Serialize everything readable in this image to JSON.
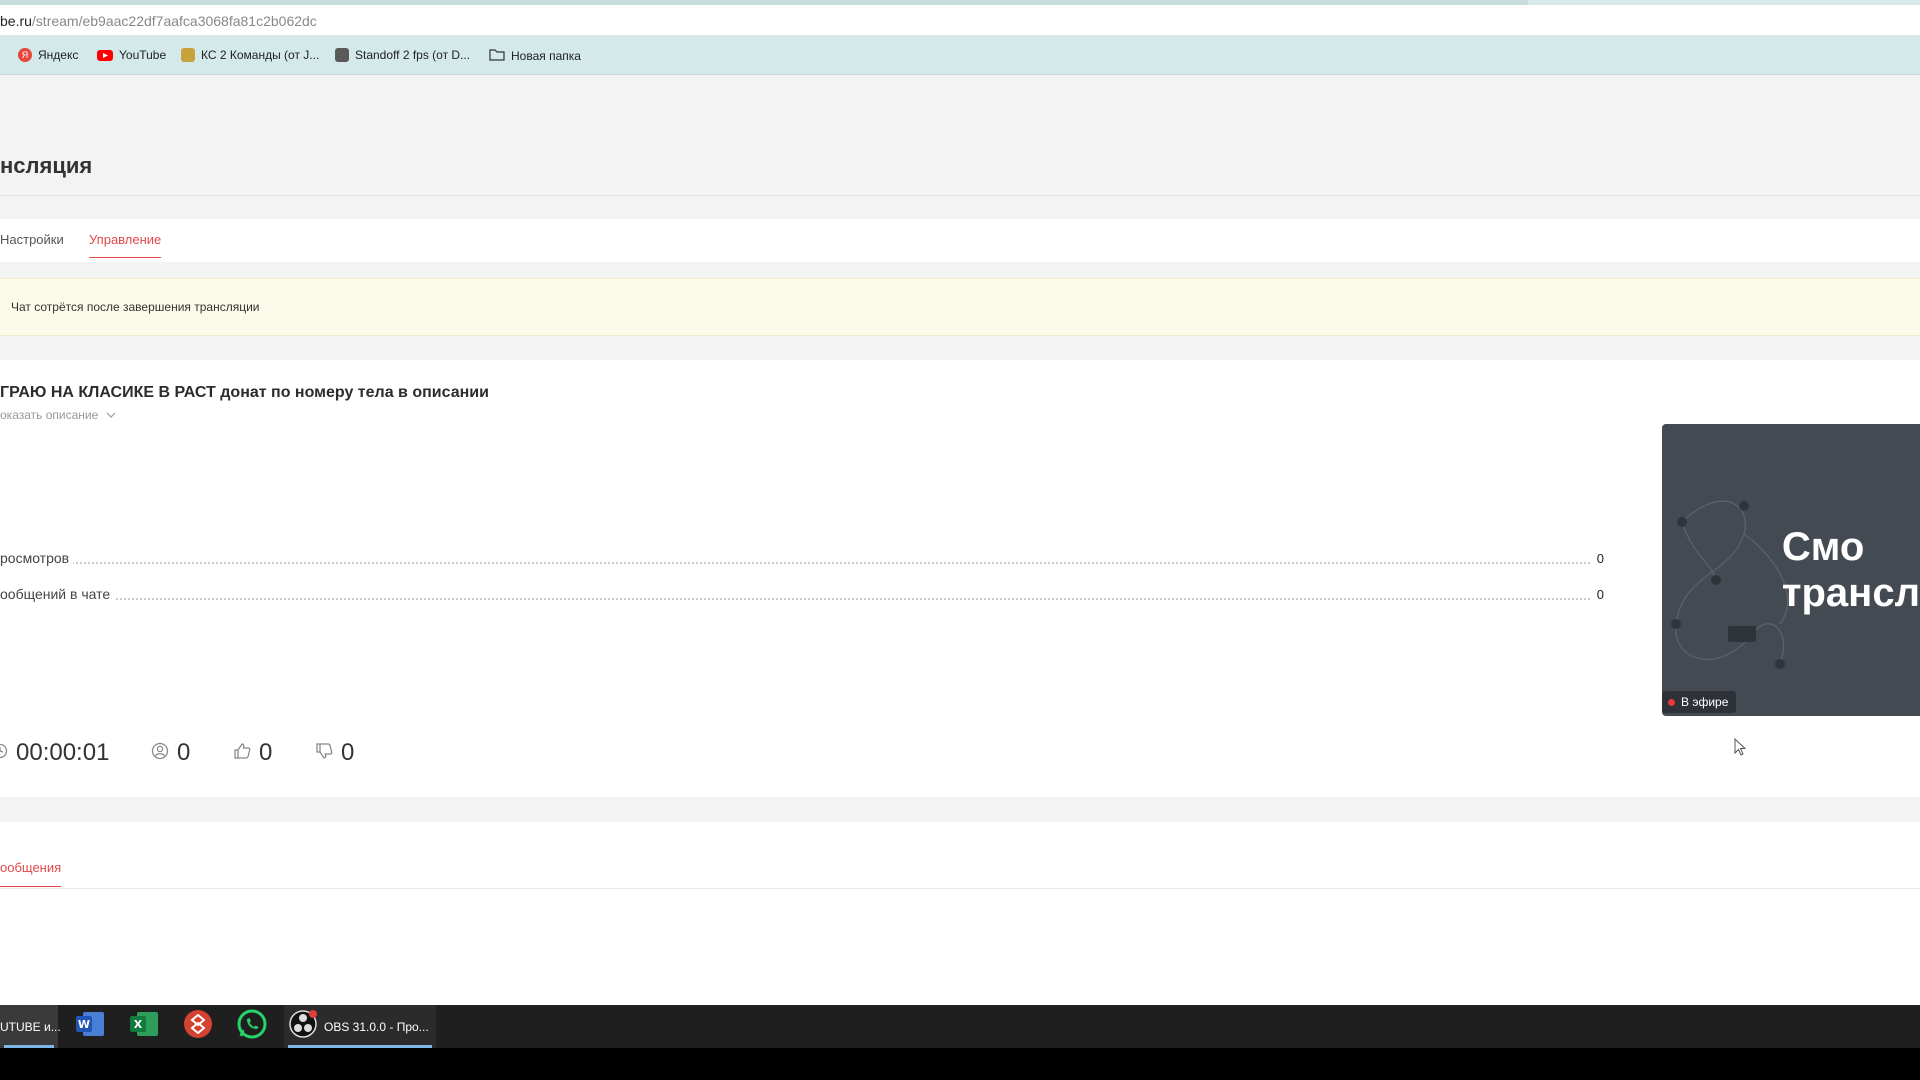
{
  "browser": {
    "url_host": "be.ru",
    "url_path": "/stream/eb9aac22df7aafca3068fa81c2b062dc"
  },
  "bookmarks": [
    {
      "label": "Яндекс",
      "icon": "yandex-icon",
      "color": "#e8453c"
    },
    {
      "label": "YouTube",
      "icon": "youtube-icon",
      "color": "#ff0000"
    },
    {
      "label": "КС 2 Команды (от J...",
      "icon": "bookmark-favicon-icon",
      "color": "#c8a23a"
    },
    {
      "label": "Standoff 2 fps (от D...",
      "icon": "bookmark-favicon-icon",
      "color": "#5a5a5a"
    },
    {
      "label": "Новая папка",
      "icon": "folder-icon",
      "color": "#333333"
    }
  ],
  "page": {
    "title": "нсляция",
    "tabs": [
      "Настройки",
      "Управление"
    ],
    "active_tab": "Управление",
    "notice": "Чат сотрётся после завершения трансляции"
  },
  "stream": {
    "title": "ГРАЮ НА КЛАСИКЕ В РАСТ донат по номеру тела в описании",
    "description_toggle": "оказать описание",
    "stats": [
      {
        "label": "росмотров",
        "value": "0"
      },
      {
        "label": "ообщений в чате",
        "value": "0"
      }
    ],
    "preview_text_line1": "Смо",
    "preview_text_line2": "трансл",
    "live_badge": "В эфире",
    "metrics": {
      "duration": "00:00:01",
      "viewers": "0",
      "likes": "0",
      "dislikes": "0"
    }
  },
  "chat": {
    "tab": "ообщения"
  },
  "taskbar": {
    "items": [
      {
        "label": "UTUBE и...",
        "icon": "browser-icon"
      },
      {
        "label": "",
        "icon": "word-icon"
      },
      {
        "label": "",
        "icon": "excel-icon"
      },
      {
        "label": "",
        "icon": "anydesk-icon"
      },
      {
        "label": "",
        "icon": "whatsapp-icon"
      },
      {
        "label": "OBS 31.0.0 - Про...",
        "icon": "obs-icon"
      }
    ]
  },
  "colors": {
    "accent": "#e24a4a",
    "notice_bg": "#fcfae9",
    "bookmarks_bg": "#d4e9e9",
    "preview_bg": "#444a52",
    "taskbar_bg": "#1f1f1f"
  }
}
